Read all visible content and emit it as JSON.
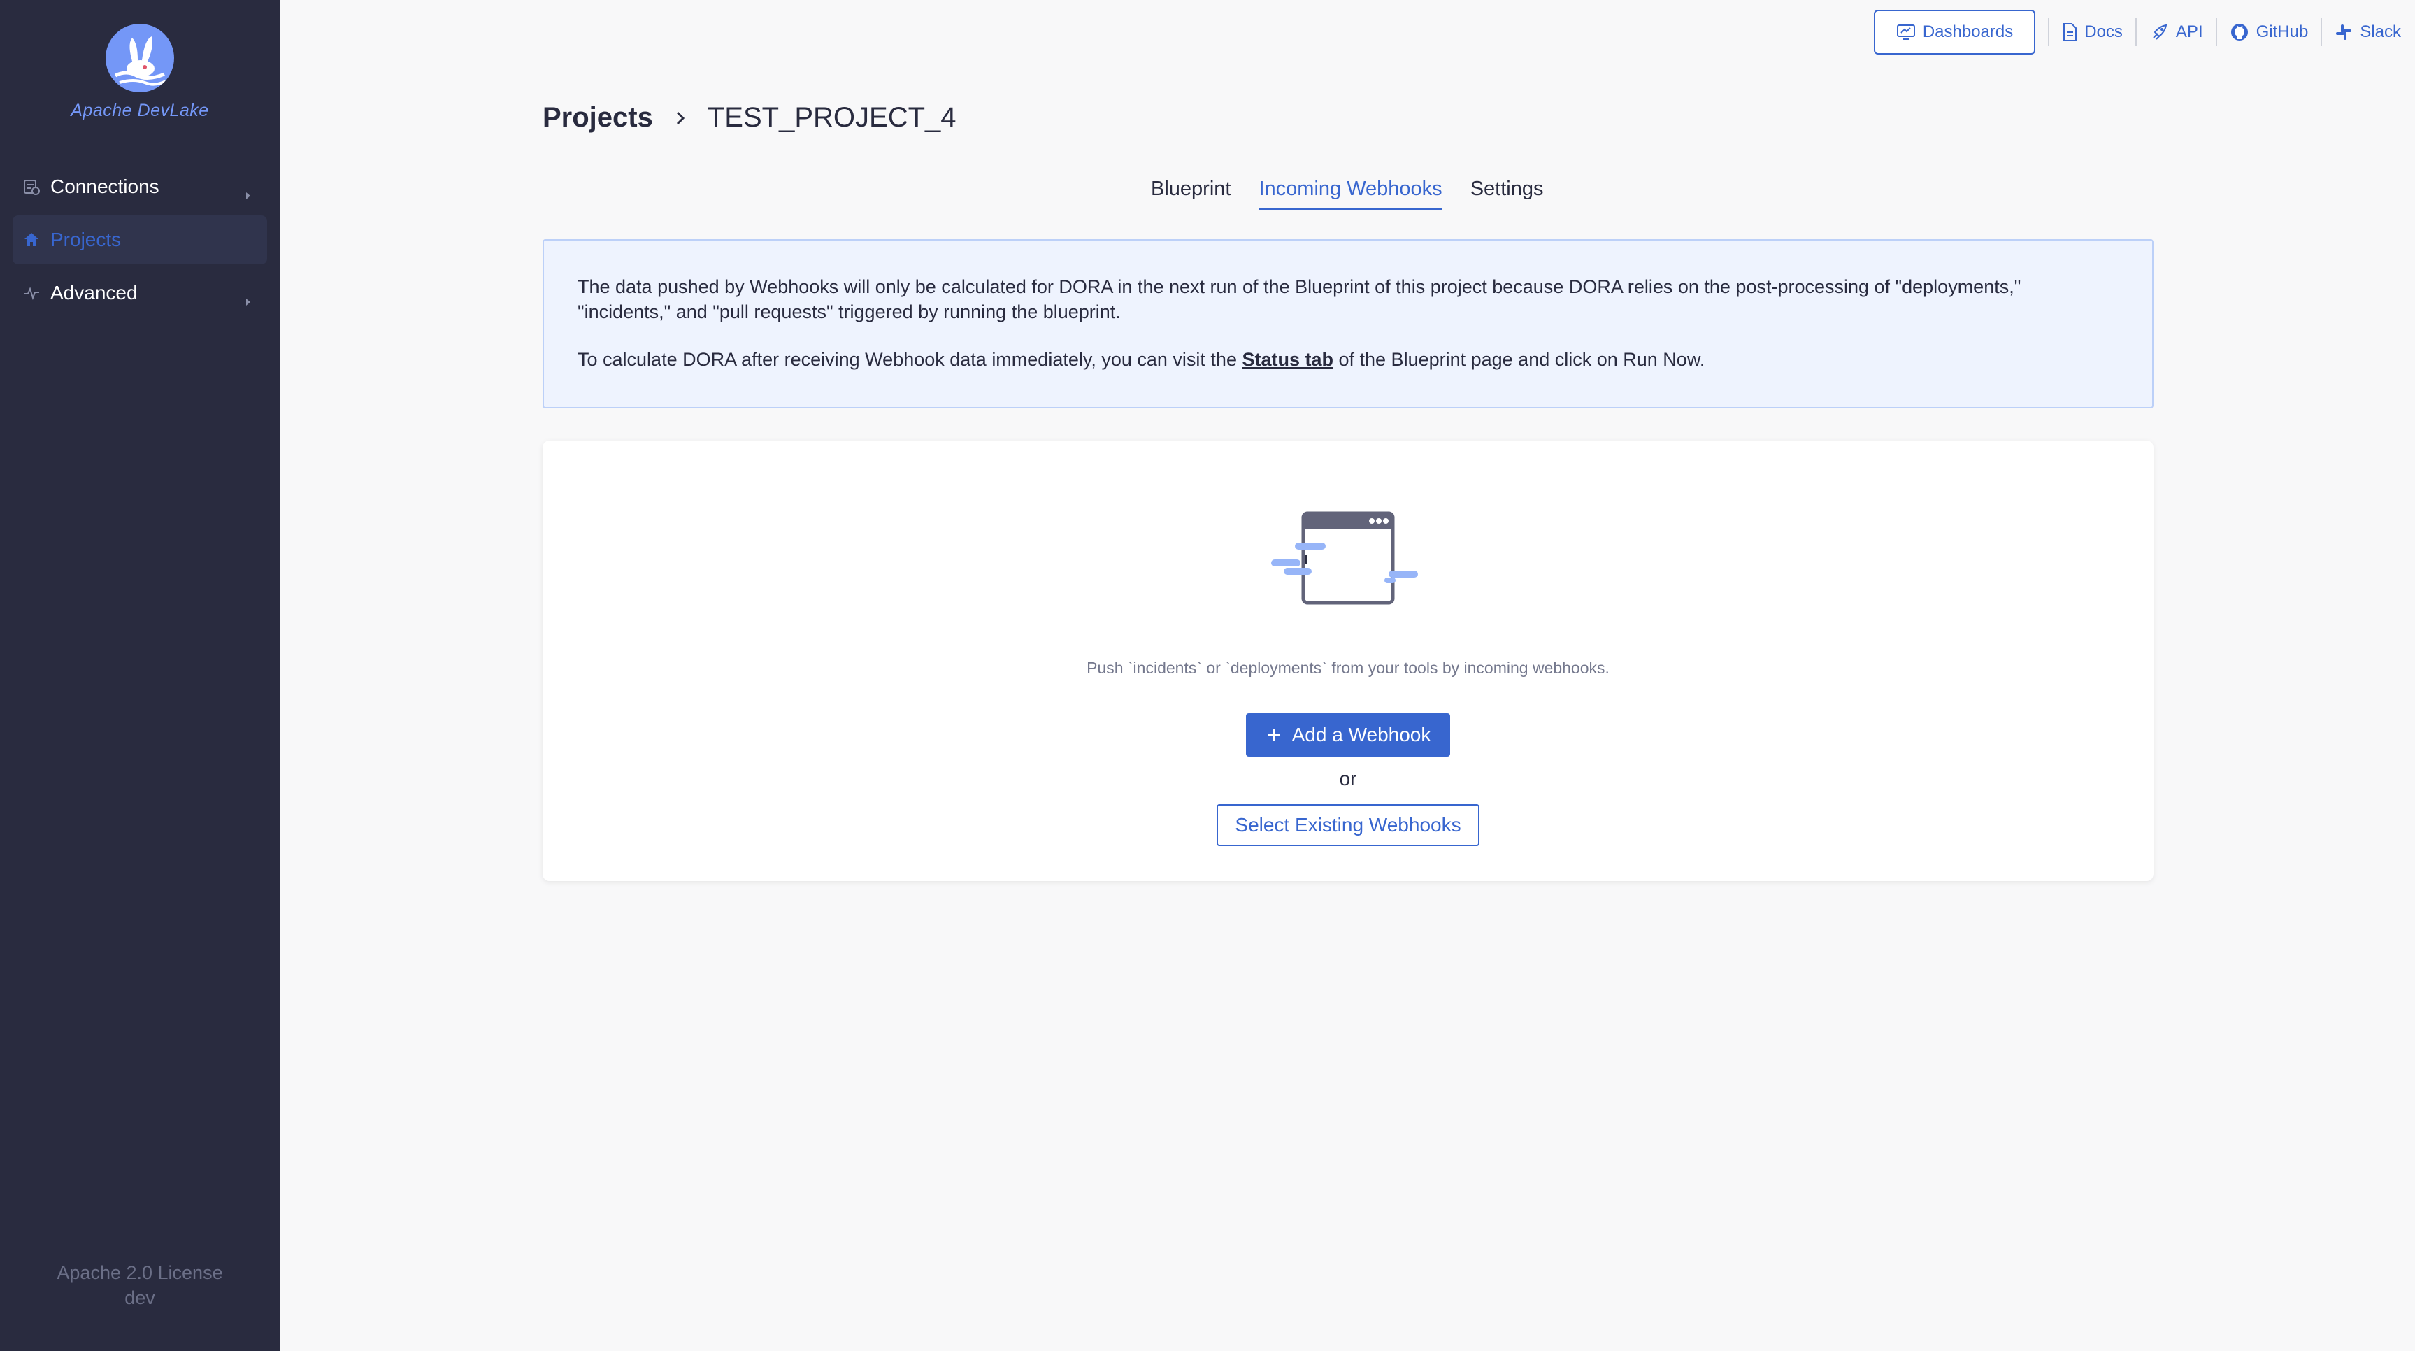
{
  "app": {
    "name": "Apache DevLake"
  },
  "sidebar": {
    "items": [
      {
        "label": "Connections",
        "icon": "database-icon",
        "expandable": true,
        "active": false
      },
      {
        "label": "Projects",
        "icon": "home-icon",
        "expandable": false,
        "active": true
      },
      {
        "label": "Advanced",
        "icon": "pulse-icon",
        "expandable": true,
        "active": false
      }
    ],
    "license": "Apache 2.0 License",
    "version": "dev"
  },
  "topbar": {
    "dashboards": "Dashboards",
    "links": [
      {
        "label": "Docs",
        "icon": "document-icon"
      },
      {
        "label": "API",
        "icon": "rocket-icon"
      },
      {
        "label": "GitHub",
        "icon": "github-icon"
      },
      {
        "label": "Slack",
        "icon": "slack-icon"
      }
    ]
  },
  "breadcrumb": {
    "root": "Projects",
    "current": "TEST_PROJECT_4"
  },
  "tabs": [
    {
      "label": "Blueprint",
      "active": false
    },
    {
      "label": "Incoming Webhooks",
      "active": true
    },
    {
      "label": "Settings",
      "active": false
    }
  ],
  "notice": {
    "line1": "The data pushed by Webhooks will only be calculated for DORA in the next run of the Blueprint of this project because DORA relies on the post-processing of \"deployments,\" \"incidents,\" and \"pull requests\" triggered by running the blueprint.",
    "line2_prefix": "To calculate DORA after receiving Webhook data immediately, you can visit the ",
    "line2_link": "Status tab",
    "line2_suffix": " of the Blueprint page and click on Run Now."
  },
  "empty_state": {
    "icon": "webhook-window-illustration",
    "message": "Push `incidents` or `deployments` from your tools by incoming webhooks.",
    "add_button": "Add a Webhook",
    "or_text": "or",
    "select_button": "Select Existing Webhooks"
  },
  "colors": {
    "sidebar_bg": "#292b3f",
    "accent": "#3866cf",
    "logo": "#7497f7",
    "page_bg": "#f8f8f9",
    "notice_bg": "#eef3fe"
  }
}
